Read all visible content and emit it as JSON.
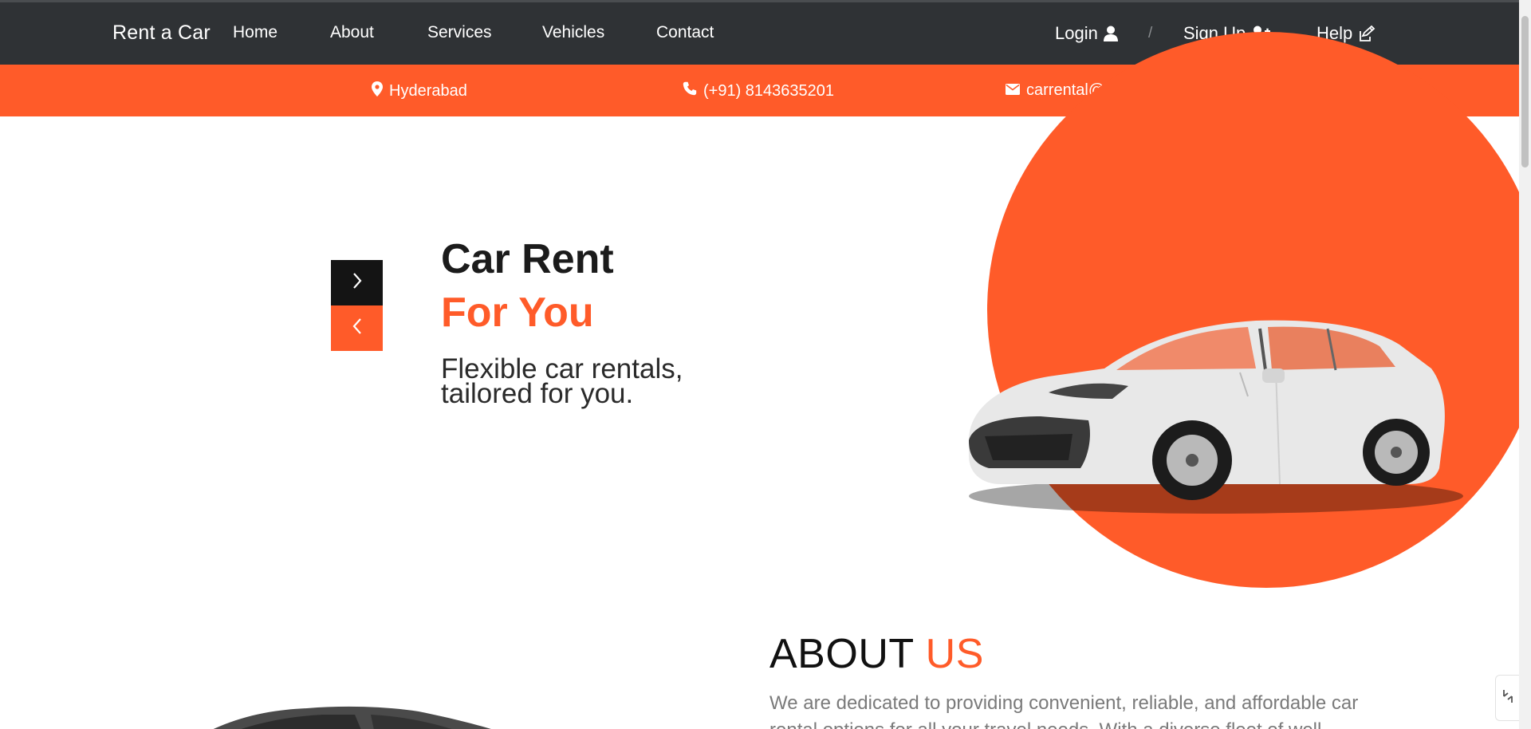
{
  "nav": {
    "brand": "Rent a Car",
    "links": [
      "Home",
      "About",
      "Services",
      "Vehicles",
      "Contact"
    ],
    "login": "Login",
    "separator": "/",
    "signup": "Sign Up",
    "help": "Help"
  },
  "contact": {
    "location": "Hyderabad",
    "phone": "(+91) 8143635201",
    "email": "carrental@gmail.com"
  },
  "hero": {
    "title_line1": "Car Rent",
    "title_line2": "For You",
    "subtitle": "Flexible car rentals, tailored for you."
  },
  "about": {
    "title_main": "ABOUT",
    "title_accent": "US",
    "text": "We are dedicated to providing convenient, reliable, and affordable car rental options for all your travel needs. With a diverse fleet of well-"
  },
  "colors": {
    "accent": "#ff5b29",
    "navbar": "#2f3235",
    "dark_button": "#141414"
  },
  "icons": {
    "location": "map-pin-icon",
    "phone": "phone-icon",
    "email": "envelope-icon",
    "login": "user-icon",
    "signup": "user-plus-icon",
    "help": "pencil-square-icon",
    "next": "chevron-right-icon",
    "prev": "chevron-left-icon"
  }
}
